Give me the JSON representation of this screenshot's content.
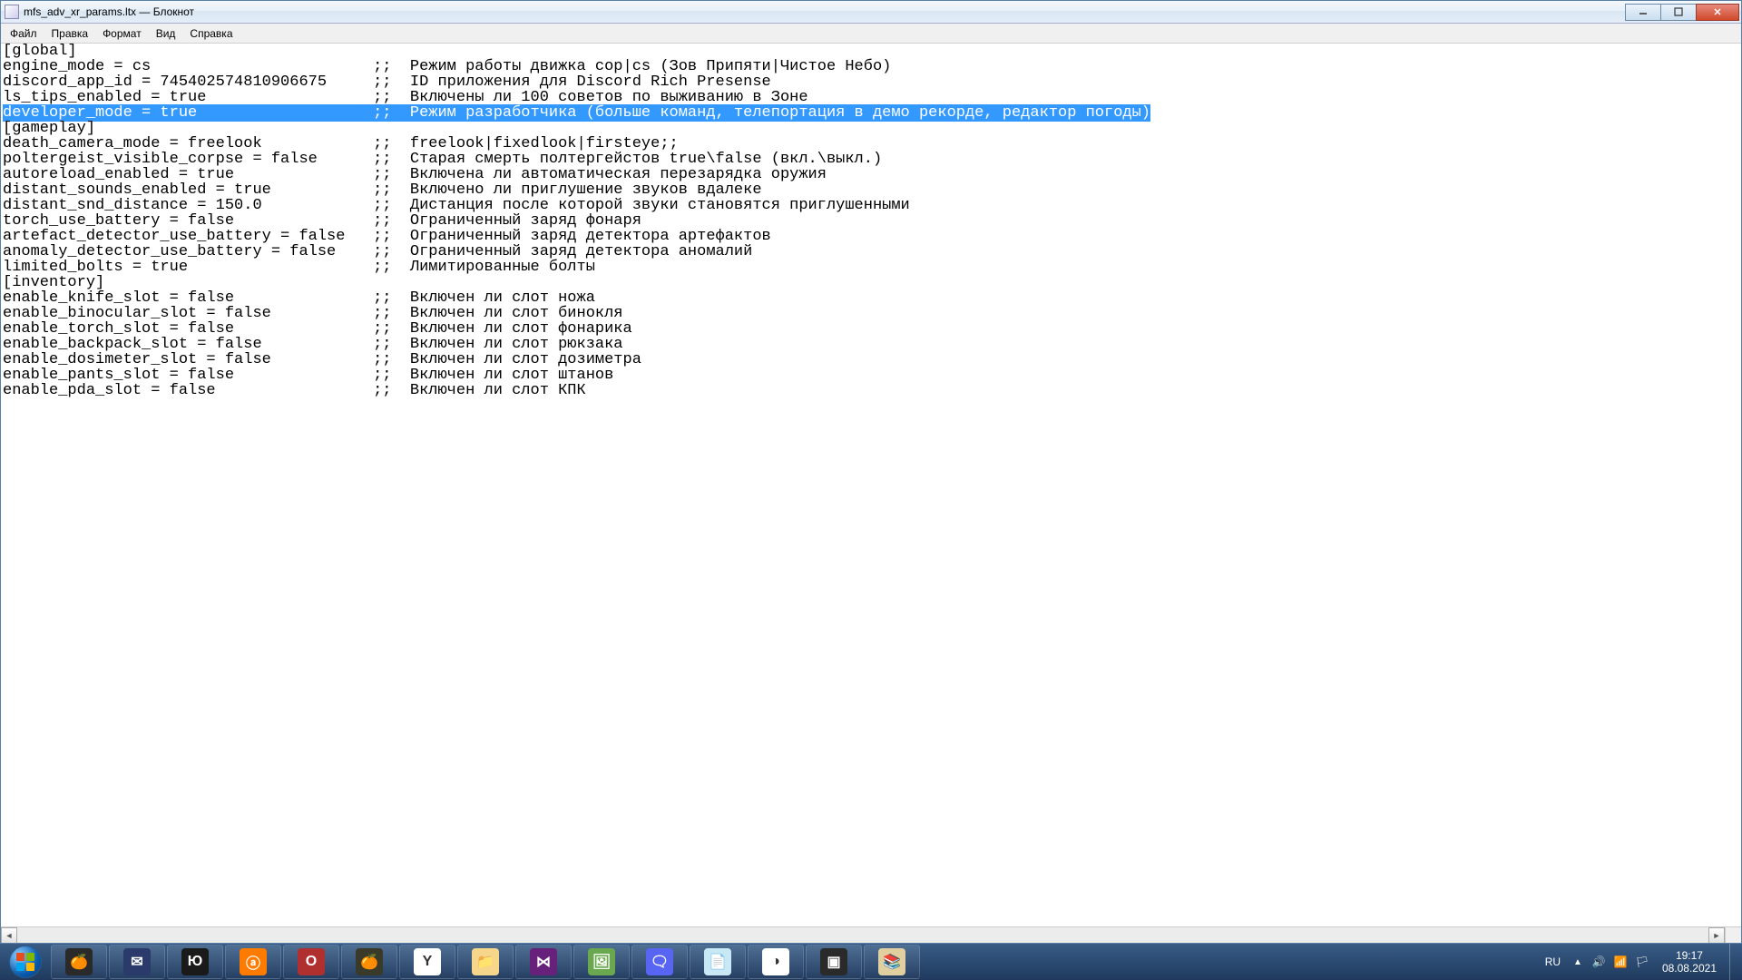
{
  "window": {
    "title": "mfs_adv_xr_params.ltx — Блокнот"
  },
  "menu": {
    "file": "Файл",
    "edit": "Правка",
    "format": "Формат",
    "view": "Вид",
    "help": "Справка"
  },
  "editor": {
    "lines": [
      "[global]",
      "engine_mode = cs                        ;;  Режим работы движка cop|cs (Зов Припяти|Чистое Небо)",
      "discord_app_id = 745402574810906675     ;;  ID приложения для Discord Rich Presense",
      "ls_tips_enabled = true                  ;;  Включены ли 100 советов по выживанию в Зоне",
      "",
      "",
      "[gameplay]",
      "death_camera_mode = freelook            ;;  freelook|fixedlook|firsteye;;",
      "poltergeist_visible_corpse = false      ;;  Старая смерть полтергейстов true\\false (вкл.\\выкл.)",
      "autoreload_enabled = true               ;;  Включена ли автоматическая перезарядка оружия",
      "distant_sounds_enabled = true           ;;  Включено ли приглушение звуков вдалеке",
      "distant_snd_distance = 150.0            ;;  Дистанция после которой звуки становятся приглушенными",
      "torch_use_battery = false               ;;  Ограниченный заряд фонаря",
      "artefact_detector_use_battery = false   ;;  Ограниченный заряд детектора артефактов",
      "anomaly_detector_use_battery = false    ;;  Ограниченный заряд детектора аномалий",
      "limited_bolts = true                    ;;  Лимитированные болты",
      "",
      "[inventory]",
      "enable_knife_slot = false               ;;  Включен ли слот ножа",
      "enable_binocular_slot = false           ;;  Включен ли слот бинокля",
      "enable_torch_slot = false               ;;  Включен ли слот фонарика",
      "enable_backpack_slot = false            ;;  Включен ли слот рюкзака",
      "enable_dosimeter_slot = false           ;;  Включен ли слот дозиметра",
      "enable_pants_slot = false               ;;  Включен ли слот штанов",
      "enable_pda_slot = false                 ;;  Включен ли слот КПК"
    ],
    "selected_line": "developer_mode = true                   ;;  Режим разработчика (больше команд, телепортация в демо рекорде, редактор погоды)",
    "selected_index": 4
  },
  "taskbar": {
    "apps": [
      {
        "name": "fl-studio",
        "bg": "#2a2a2a",
        "glyph": "🍊"
      },
      {
        "name": "mail",
        "bg": "#2a3a6a",
        "glyph": "✉"
      },
      {
        "name": "yandex-u",
        "bg": "#1a1a1a",
        "glyph": "Ю"
      },
      {
        "name": "avast",
        "bg": "#ff7b00",
        "glyph": "ⓐ"
      },
      {
        "name": "opera",
        "bg": "#b03030",
        "glyph": "O"
      },
      {
        "name": "fl-studio-2",
        "bg": "#3a3a2a",
        "glyph": "🍊"
      },
      {
        "name": "yandex-browser",
        "bg": "#ffffff",
        "glyph": "Y"
      },
      {
        "name": "explorer",
        "bg": "#f5d68a",
        "glyph": "📁"
      },
      {
        "name": "visual-studio",
        "bg": "#68217a",
        "glyph": "⋈"
      },
      {
        "name": "app-green",
        "bg": "#6aa84f",
        "glyph": "🖼"
      },
      {
        "name": "discord",
        "bg": "#5865f2",
        "glyph": "🗨"
      },
      {
        "name": "notepad",
        "bg": "#c9e8f5",
        "glyph": "📄"
      },
      {
        "name": "github",
        "bg": "#ffffff",
        "glyph": "◑"
      },
      {
        "name": "terminal",
        "bg": "#2a2a2a",
        "glyph": "▣"
      },
      {
        "name": "winrar",
        "bg": "#e0d0a0",
        "glyph": "📚"
      }
    ]
  },
  "tray": {
    "lang": "RU",
    "time": "19:17",
    "date": "08.08.2021"
  }
}
